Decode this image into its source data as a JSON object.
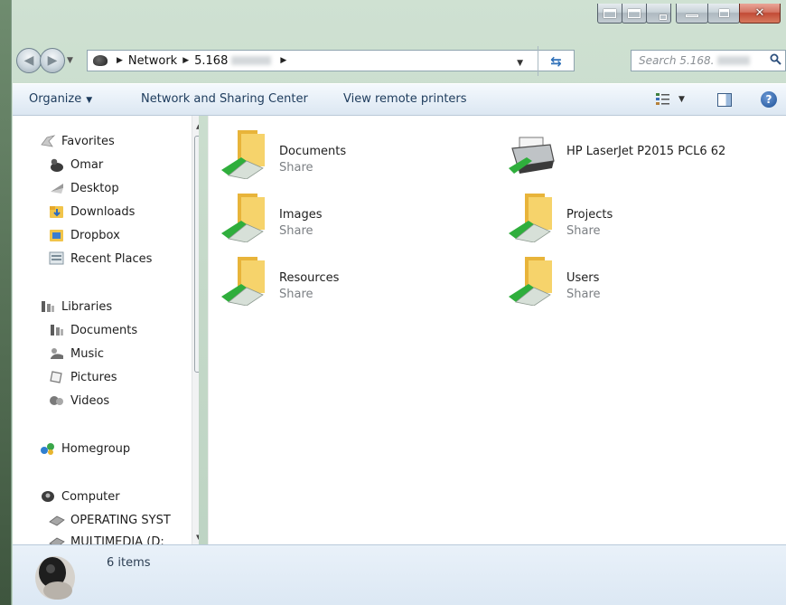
{
  "address": {
    "crumbs": [
      "Network",
      "5.168"
    ],
    "search_placeholder": "Search 5.168."
  },
  "toolbar": {
    "organize": "Organize",
    "network_sharing": "Network and Sharing Center",
    "remote_printers": "View remote printers"
  },
  "nav": {
    "favorites": "Favorites",
    "omar": "Omar",
    "desktop": "Desktop",
    "downloads": "Downloads",
    "dropbox": "Dropbox",
    "recent_places": "Recent Places",
    "libraries": "Libraries",
    "lib_documents": "Documents",
    "music": "Music",
    "pictures": "Pictures",
    "videos": "Videos",
    "homegroup": "Homegroup",
    "computer": "Computer",
    "os_drive": "OPERATING SYST",
    "multimedia_drive": "MULTIMEDIA (D:"
  },
  "items": [
    {
      "name": "Documents",
      "sub": "Share"
    },
    {
      "name": "HP LaserJet P2015 PCL6 62",
      "sub": ""
    },
    {
      "name": "Images",
      "sub": "Share"
    },
    {
      "name": "Projects",
      "sub": "Share"
    },
    {
      "name": "Resources",
      "sub": "Share"
    },
    {
      "name": "Users",
      "sub": "Share"
    }
  ],
  "status": {
    "count": "6 items"
  },
  "colors": {
    "folder": "#f3c64b",
    "share_cable": "#2fae3c",
    "accent": "#1d3b5c"
  }
}
